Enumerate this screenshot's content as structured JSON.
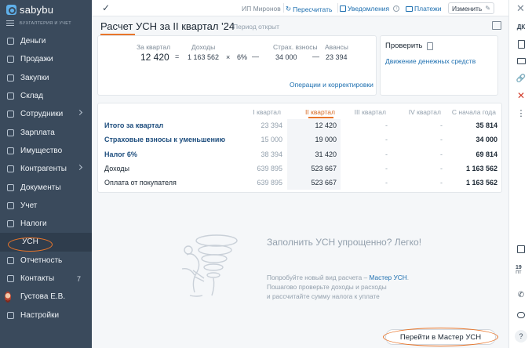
{
  "app": {
    "logo": "sabybu",
    "subtitle": "БУХГАЛТЕРИЯ И УЧЕТ"
  },
  "sidebar": {
    "items": [
      {
        "label": "Деньги",
        "icon": "ruble-icon"
      },
      {
        "label": "Продажи",
        "icon": "cart-icon"
      },
      {
        "label": "Закупки",
        "icon": "bag-icon"
      },
      {
        "label": "Склад",
        "icon": "box-icon"
      },
      {
        "label": "Сотрудники",
        "icon": "people-icon",
        "has_submenu": true
      },
      {
        "label": "Зарплата",
        "icon": "payroll-icon"
      },
      {
        "label": "Имущество",
        "icon": "building-icon"
      },
      {
        "label": "Контрагенты",
        "icon": "handshake-icon",
        "has_submenu": true
      },
      {
        "label": "Документы",
        "icon": "documents-icon"
      },
      {
        "label": "Учет",
        "icon": "ledger-icon"
      },
      {
        "label": "Налоги",
        "icon": "taxes-icon"
      },
      {
        "label": "УСН",
        "submenu_item": true,
        "active": true
      },
      {
        "label": "Отчетность",
        "icon": "report-icon"
      },
      {
        "label": "Контакты",
        "icon": "chat-icon",
        "count": "7"
      },
      {
        "label": "Густова Е.В.",
        "icon": "avatar"
      },
      {
        "label": "Настройки",
        "icon": "gear-icon"
      }
    ]
  },
  "topbar": {
    "org": "ИП Миронов",
    "recalc": "Пересчитать",
    "notifications": "Уведомления",
    "payments": "Платежи",
    "edit": "Изменить"
  },
  "page": {
    "title": "Расчет УСН за II квартал '24",
    "period_status": "Период открыт"
  },
  "calc": {
    "q_label": "За квартал",
    "q_value": "12 420",
    "income_label": "Доходы",
    "income_value": "1 163 562",
    "rate": "6%",
    "contrib_label": "Страх. взносы",
    "contrib_value": "34 000",
    "advance_label": "Авансы",
    "advance_value": "23 394",
    "op_equals": "=",
    "op_times": "×",
    "op_minus": "—",
    "ops_link": "Операции и корректировки"
  },
  "check": {
    "title": "Проверить",
    "link": "Движение денежных средств"
  },
  "table": {
    "headers": [
      "I квартал",
      "II квартал",
      "III квартал",
      "IV квартал",
      "С начала года"
    ],
    "rows": [
      {
        "name": "Итого за квартал",
        "link": true,
        "q1": "23 394",
        "q2": "12 420",
        "q3": "-",
        "q4": "-",
        "ytd": "35 814"
      },
      {
        "name": "Страховые взносы к уменьшению",
        "link": true,
        "q1": "15 000",
        "q2": "19 000",
        "q3": "-",
        "q4": "-",
        "ytd": "34 000"
      },
      {
        "name": "Налог 6%",
        "link": true,
        "q1": "38 394",
        "q2": "31 420",
        "q3": "-",
        "q4": "-",
        "ytd": "69 814"
      },
      {
        "name": "Доходы",
        "link": false,
        "q1": "639 895",
        "q2": "523 667",
        "q3": "-",
        "q4": "-",
        "ytd": "1 163 562"
      },
      {
        "name": "Оплата от покупателя",
        "link": false,
        "q1": "639 895",
        "q2": "523 667",
        "q3": "-",
        "q4": "-",
        "ytd": "1 163 562"
      }
    ]
  },
  "promo": {
    "title": "Заполнить УСН упрощенно? Легко!",
    "line1_prefix": "Попробуйте новый вид расчета – ",
    "line1_link": "Мастер УСН",
    "line1_suffix": ".",
    "line2": "Пошагово проверьте доходы и расходы",
    "line3": "и рассчитайте сумму налога к уплате",
    "cta": "Перейти в Мастер УСН"
  },
  "rail": {
    "close": "✕",
    "dk": "ДК",
    "date_day": "19",
    "date_month": "ПТ",
    "help": "?"
  },
  "colors": {
    "sidebar": "#3a4a5c",
    "accent": "#e8752a",
    "link": "#1d6fb0"
  }
}
